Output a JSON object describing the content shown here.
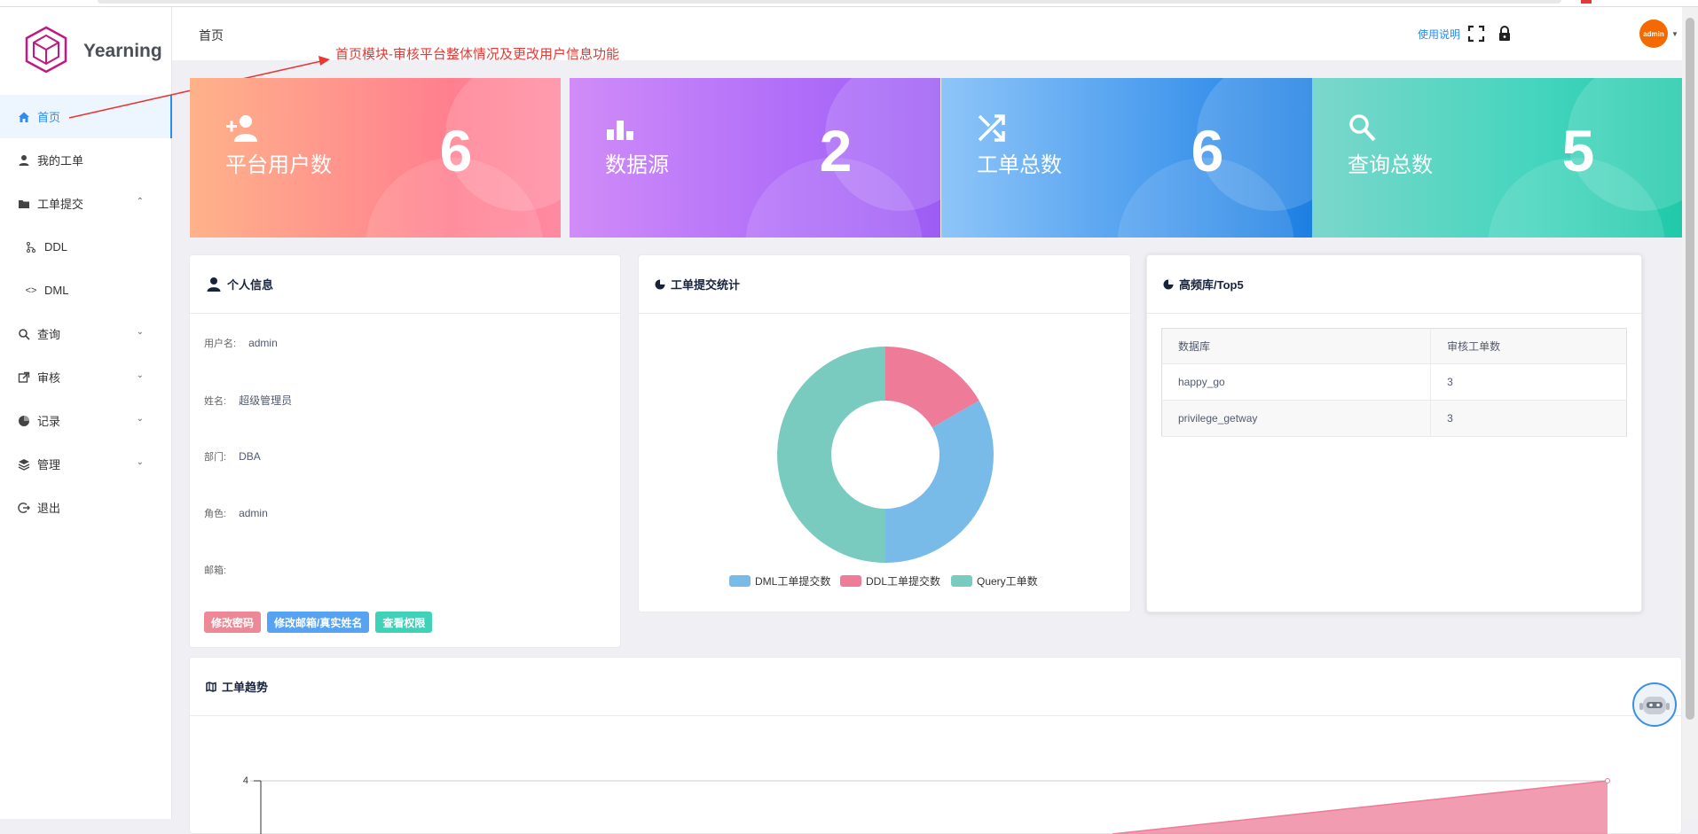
{
  "app": {
    "title": "Yearning"
  },
  "header": {
    "breadcrumb": "首页",
    "help_label": "使用说明",
    "avatar_text": "admin"
  },
  "annotation": "首页模块-审核平台整体情况及更改用户信息功能",
  "sidebar": {
    "items": [
      {
        "label": "首页"
      },
      {
        "label": "我的工单"
      },
      {
        "label": "工单提交"
      },
      {
        "label": "DDL"
      },
      {
        "label": "DML"
      },
      {
        "label": "查询"
      },
      {
        "label": "审核"
      },
      {
        "label": "记录"
      },
      {
        "label": "管理"
      },
      {
        "label": "退出"
      }
    ]
  },
  "stats": [
    {
      "label": "平台用户数",
      "value": "6",
      "icon": "add-user-icon"
    },
    {
      "label": "数据源",
      "value": "2",
      "icon": "bar-chart-icon"
    },
    {
      "label": "工单总数",
      "value": "6",
      "icon": "shuffle-icon"
    },
    {
      "label": "查询总数",
      "value": "5",
      "icon": "search-icon"
    }
  ],
  "profile": {
    "title": "个人信息",
    "fields": [
      {
        "label": "用户名:",
        "value": "admin"
      },
      {
        "label": "姓名:",
        "value": "超级管理员"
      },
      {
        "label": "部门:",
        "value": "DBA"
      },
      {
        "label": "角色:",
        "value": "admin"
      },
      {
        "label": "邮箱:",
        "value": ""
      }
    ],
    "buttons": [
      "修改密码",
      "修改邮箱/真实姓名",
      "查看权限"
    ]
  },
  "submit_stats": {
    "title": "工单提交统计",
    "legend": [
      "DML工单提交数",
      "DDL工单提交数",
      "Query工单数"
    ]
  },
  "top5": {
    "title": "高频库/Top5",
    "columns": [
      "数据库",
      "审核工单数"
    ],
    "rows": [
      [
        "happy_go",
        "3"
      ],
      [
        "privilege_getway",
        "3"
      ]
    ]
  },
  "trend": {
    "title": "工单趋势",
    "y_tick": "4"
  },
  "colors": {
    "dml": "#78bbe9",
    "ddl": "#ee7b97",
    "query": "#7acbbf",
    "accent": "#2d8cf0"
  },
  "chart_data": [
    {
      "type": "pie",
      "categories": [
        "DML工单提交数",
        "DDL工单提交数",
        "Query工单数"
      ],
      "values": [
        2,
        1,
        3
      ]
    },
    {
      "type": "area",
      "title": "工单趋势",
      "y_ticks": [
        4
      ]
    }
  ]
}
